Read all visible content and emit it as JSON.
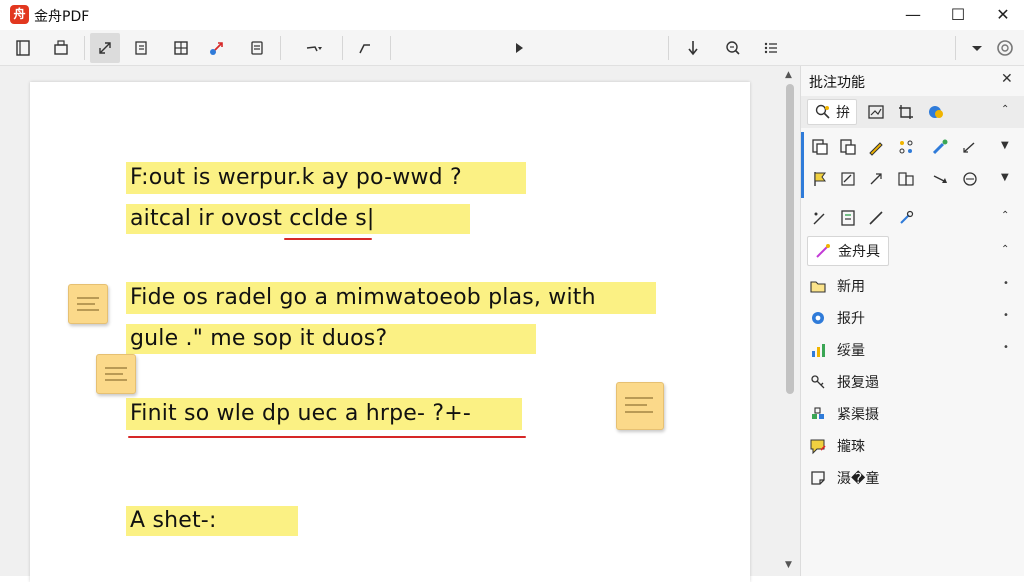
{
  "window": {
    "title": "金舟PDF",
    "logo_glyph": "舟",
    "minimize": "—",
    "maximize": "☐",
    "close": "✕"
  },
  "toolbar": {
    "buttons": [
      {
        "icon": "page-icon"
      },
      {
        "icon": "print-icon"
      },
      {
        "icon": "select-arrow-icon",
        "active": true
      },
      {
        "icon": "text-select-icon"
      },
      {
        "icon": "grid-icon"
      },
      {
        "icon": "share-icon"
      },
      {
        "icon": "document-icon"
      },
      {
        "icon": "arrow-dropdown-icon"
      },
      {
        "icon": "corner-tool-icon"
      },
      {
        "icon": "play-icon"
      },
      {
        "icon": "download-arrow-icon"
      },
      {
        "icon": "zoom-icon"
      },
      {
        "icon": "list-icon"
      },
      {
        "icon": "dropdown-caret-icon"
      },
      {
        "icon": "settings-circle-icon"
      }
    ]
  },
  "document": {
    "lines": [
      {
        "text": "F:out is werpur.k ay po-wwd  ?"
      },
      {
        "text": "aitcal ir ovost cclde s|"
      },
      {
        "text": "Fide os radel go a mimwatoeob plas, with"
      },
      {
        "text": "gule .\" me sop it duos?"
      },
      {
        "text": "Finit so wle dp uec a hrpe- ?+-"
      },
      {
        "text": "A shet-:"
      }
    ]
  },
  "panel": {
    "title": "批注功能",
    "close": "✕",
    "active_tab_label": "拚",
    "feature_button": "金舟具",
    "items": [
      {
        "label": "新用"
      },
      {
        "label": "报升"
      },
      {
        "label": "绥量"
      },
      {
        "label": "报复遢"
      },
      {
        "label": "紧渠摄"
      },
      {
        "label": "攏琜"
      },
      {
        "label": "滠�童"
      }
    ]
  },
  "colors": {
    "highlight": "#fbf184",
    "underline": "#d62828",
    "note": "#fbd98a",
    "accent_blue": "#2f7bd9",
    "logo_red": "#e2371f"
  }
}
